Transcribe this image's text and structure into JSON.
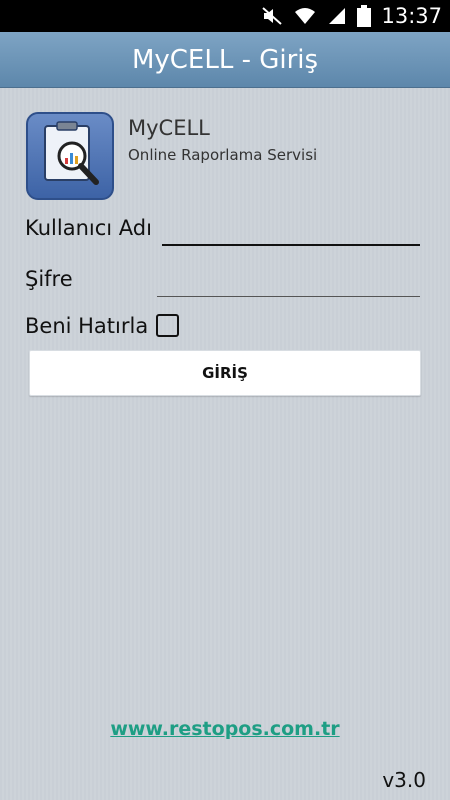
{
  "status_bar": {
    "time": "13:37",
    "icons": [
      "mute-icon",
      "wifi-icon",
      "signal-icon",
      "battery-icon"
    ]
  },
  "header": {
    "title": "MyCELL - Giriş"
  },
  "app_info": {
    "name": "MyCELL",
    "subtitle": "Online Raporlama Servisi"
  },
  "form": {
    "username_label": "Kullanıcı Adı",
    "username_value": "",
    "password_label": "Şifre",
    "password_value": "",
    "remember_label": "Beni Hatırla",
    "remember_checked": false,
    "login_button": "GİRİŞ"
  },
  "footer": {
    "website": "www.restopos.com.tr",
    "version": "v3.0"
  },
  "colors": {
    "title_bar": "#6b93b7",
    "background": "#c9cfd6",
    "link": "#1e9e84",
    "app_icon": "#4f74b6"
  }
}
